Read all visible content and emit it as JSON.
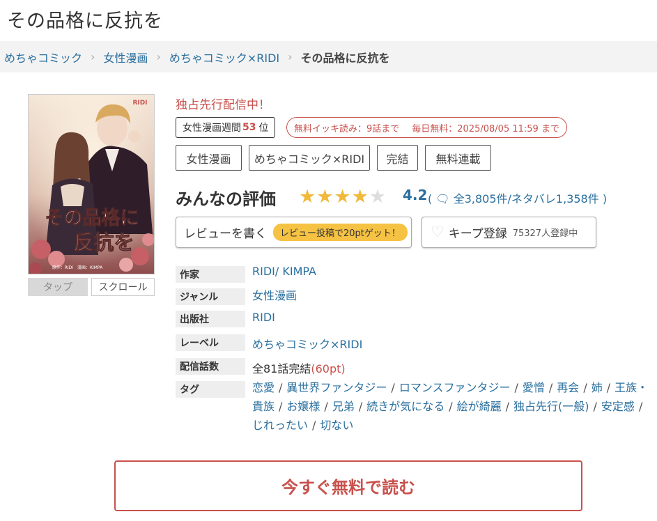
{
  "page_title": "その品格に反抗を",
  "breadcrumb": {
    "items": [
      "めちゃコミック",
      "女性漫画",
      "めちゃコミック×RIDI"
    ],
    "current": "その品格に反抗を"
  },
  "cover": {
    "publisher_mark": "RIDI",
    "title_line1": "その品格に",
    "title_line2": "反抗を",
    "credits": "原作：RIDI　漫画：KIMPA"
  },
  "view_tabs": {
    "tap": "タップ",
    "scroll": "スクロール"
  },
  "exclusive": "独占先行配信中！",
  "rank": {
    "prefix": "女性漫画週間",
    "number": "53",
    "suffix": "位"
  },
  "free_badge": {
    "part1": "無料イッキ読み：9話まで",
    "part2": "毎日無料：2025/08/05 11:59 まで"
  },
  "tags_top": [
    "女性漫画",
    "めちゃコミック×RIDI",
    "完結",
    "無料連載"
  ],
  "rating": {
    "title": "みんなの評価",
    "score": "4.2",
    "stars_filled": 4,
    "stars_total": 5,
    "review_text": "( 🗨 全3,805件/ネタバレ1,358件 )"
  },
  "review_button": {
    "label": "レビューを書く",
    "promo": "レビュー投稿で20ptゲット！"
  },
  "keep_button": {
    "icon": "heart-icon",
    "label": "キープ登録",
    "count": "75327人登録中"
  },
  "info": {
    "author_label": "作家",
    "author_value": "RIDI/ KIMPA",
    "genre_label": "ジャンル",
    "genre_value": "女性漫画",
    "publisher_label": "出版社",
    "publisher_value": "RIDI",
    "label_label": "レーベル",
    "label_value": "めちゃコミック×RIDI",
    "episodes_label": "配信話数",
    "episodes_value": "全81話完結",
    "episodes_pt": "(60pt)",
    "tags_label": "タグ"
  },
  "tags": [
    "恋愛",
    "異世界ファンタジー",
    "ロマンスファンタジー",
    "愛憎",
    "再会",
    "姉",
    "王族・貴族",
    "お嬢様",
    "兄弟",
    "続きが気になる",
    "絵が綺麗",
    "独占先行(一般)",
    "安定感",
    "じれったい",
    "切ない"
  ],
  "read_button": "今すぐ無料で読む",
  "colors": {
    "accent": "#c8514c",
    "link": "#2a6f9e",
    "star": "#f0b93a",
    "promo": "#f5c243"
  }
}
